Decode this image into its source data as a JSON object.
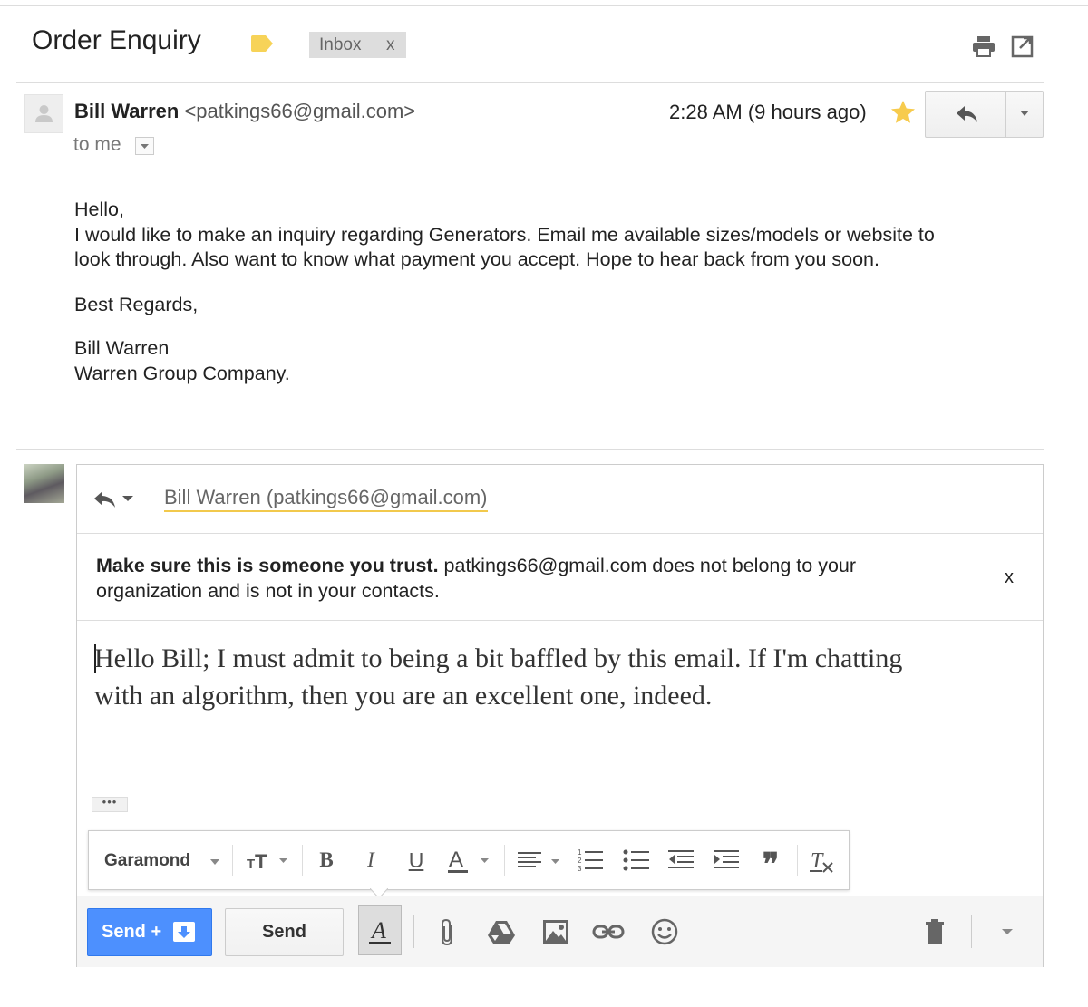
{
  "thread": {
    "subject": "Order Enquiry",
    "label_chip": "Inbox",
    "label_remove": "x"
  },
  "message": {
    "sender_name": "Bill Warren",
    "sender_email": "<patkings66@gmail.com>",
    "to": "to me",
    "time": "2:28 AM (9 hours ago)",
    "body": {
      "greeting": "Hello,",
      "line1": "I would like to make an inquiry regarding Generators. Email me available sizes/models or website to",
      "line2": "look through. Also want to know what payment you accept. Hope to hear back from you soon.",
      "closing": "Best Regards,",
      "sig_name": "Bill Warren",
      "sig_company": "Warren Group Company."
    }
  },
  "compose": {
    "recipient": "Bill Warren (patkings66@gmail.com)",
    "warning_bold": "Make sure this is someone you trust.",
    "warning_rest": " patkings66@gmail.com does not belong to your",
    "warning_line2": "organization and is not in your contacts.",
    "warning_close": "x",
    "body_line1": "Hello Bill; I must admit to being a bit baffled by this email. If I'm chatting",
    "body_line2": "with an algorithm, then you are an excellent one, indeed.",
    "ellipsis": "•••",
    "format_font": "Garamond",
    "send_archive_label": "Send +",
    "send_label": "Send"
  },
  "colors": {
    "send_blue": "#4d90fe",
    "star_yellow": "#f7cb4d",
    "label_yellow": "#f7d358",
    "chip_gray": "#dddddd",
    "link_underline": "#f2c94c"
  },
  "icons": [
    "label-tag-icon",
    "print-icon",
    "new-window-icon",
    "default-avatar-icon",
    "dropdown-arrow-icon",
    "star-icon",
    "reply-icon",
    "more-options-icon",
    "reply-mode-icon",
    "text-size-icon",
    "bold-icon",
    "italic-icon",
    "underline-icon",
    "text-color-icon",
    "align-icon",
    "numbered-list-icon",
    "bulleted-list-icon",
    "indent-less-icon",
    "indent-more-icon",
    "quote-icon",
    "remove-formatting-icon",
    "archive-icon",
    "formatting-icon",
    "attach-icon",
    "drive-icon",
    "insert-photo-icon",
    "insert-link-icon",
    "emoji-icon",
    "trash-icon",
    "more-send-options-icon"
  ]
}
